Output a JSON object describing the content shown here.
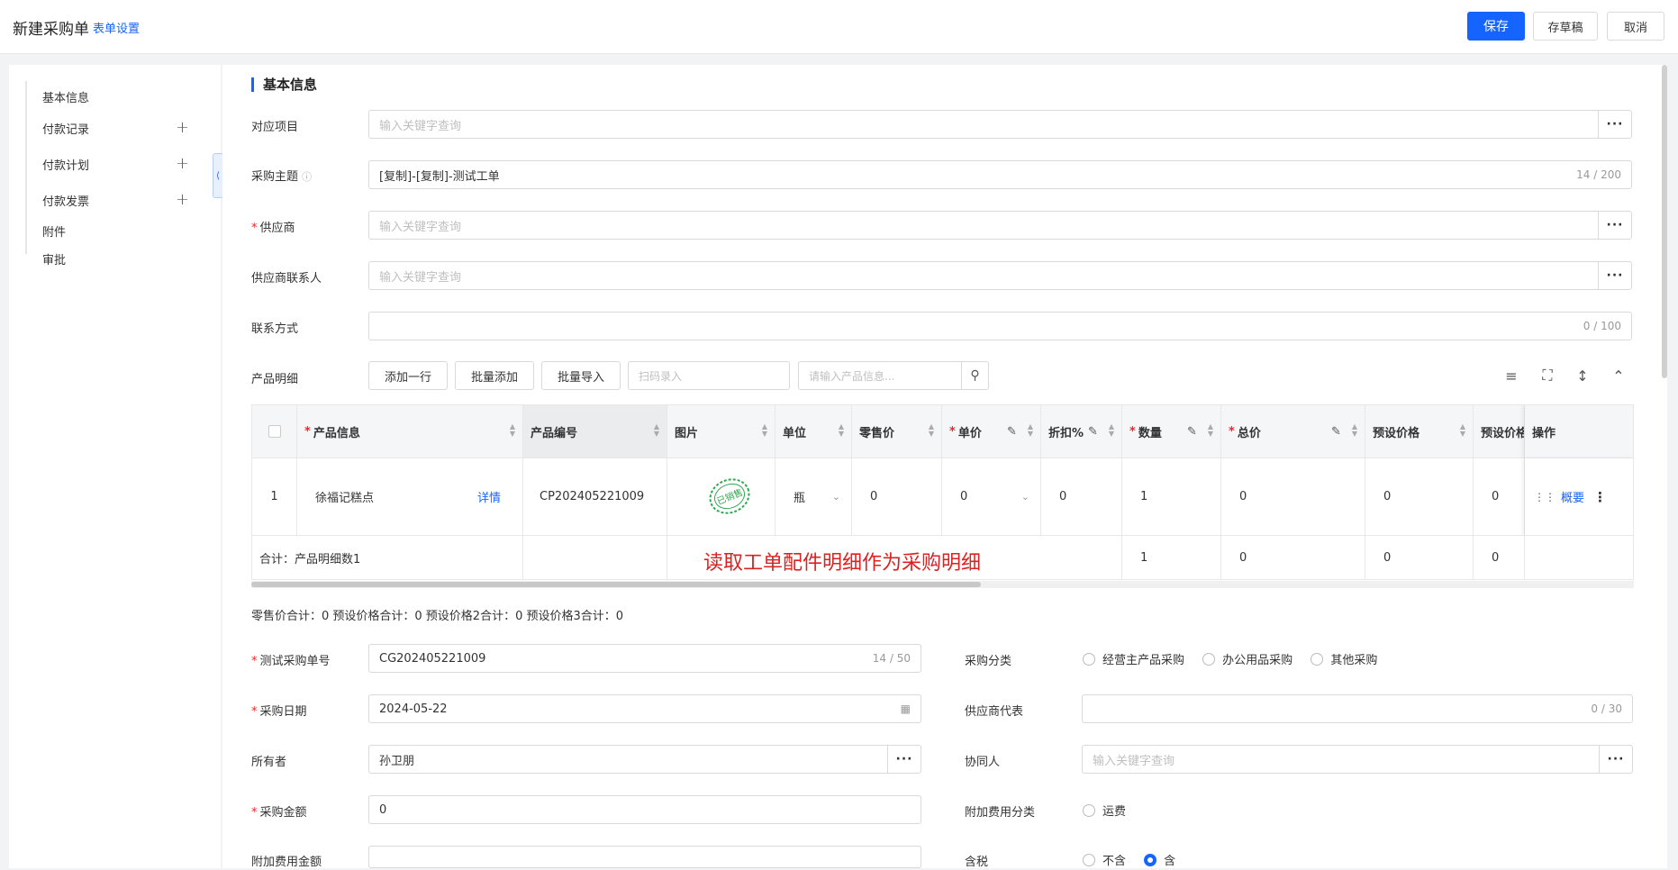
{
  "header": {
    "title": "新建采购单",
    "form_settings": "表单设置",
    "save": "保存",
    "draft": "存草稿",
    "cancel": "取消"
  },
  "sidebar": {
    "items": [
      "基本信息",
      "付款记录",
      "付款计划",
      "付款发票",
      "附件",
      "审批"
    ]
  },
  "section": {
    "title": "基本信息"
  },
  "fields": {
    "project": {
      "label": "对应项目",
      "placeholder": "输入关键字查询"
    },
    "subject": {
      "label": "采购主题",
      "value": "[复制]-[复制]-测试工单",
      "count": "14 / 200"
    },
    "supplier": {
      "label": "供应商",
      "placeholder": "输入关键字查询"
    },
    "contact": {
      "label": "供应商联系人",
      "placeholder": "输入关键字查询"
    },
    "phone": {
      "label": "联系方式",
      "count": "0 / 100"
    },
    "order_no": {
      "label": "测试采购单号",
      "value": "CG202405221009",
      "count": "14 / 50"
    },
    "category": {
      "label": "采购分类",
      "options": [
        "经营主产品采购",
        "办公用品采购",
        "其他采购"
      ]
    },
    "date": {
      "label": "采购日期",
      "value": "2024-05-22"
    },
    "rep": {
      "label": "供应商代表",
      "count": "0 / 30"
    },
    "owner": {
      "label": "所有者",
      "value": "孙卫朋"
    },
    "partner": {
      "label": "协同人",
      "placeholder": "输入关键字查询"
    },
    "amount": {
      "label": "采购金额",
      "value": "0"
    },
    "extra_category": {
      "label": "附加费用分类",
      "option": "运费"
    },
    "extra_amount": {
      "label": "附加费用金额"
    },
    "tax": {
      "label": "含税",
      "options": [
        "不含",
        "含"
      ]
    }
  },
  "products": {
    "label": "产品明细",
    "add_row": "添加一行",
    "batch_add": "批量添加",
    "batch_import": "批量导入",
    "scan_placeholder": "扫码录入",
    "search_placeholder": "请输入产品信息...",
    "columns": [
      "产品信息",
      "产品编号",
      "图片",
      "单位",
      "零售价",
      "单价",
      "折扣%",
      "数量",
      "总价",
      "预设价格",
      "预设价格",
      "操作"
    ],
    "row": {
      "index": "1",
      "name": "徐福记糕点",
      "detail": "详情",
      "code": "CP202405221009",
      "unit": "瓶",
      "retail": "0",
      "price": "0",
      "discount": "0",
      "qty": "1",
      "total": "0",
      "preset": "0",
      "preset2": "0",
      "action": "概要"
    },
    "summary": {
      "label": "合计：产品明细数1",
      "qty": "1",
      "total": "0",
      "preset": "0",
      "preset2": "0"
    },
    "stamp_text": "已销售",
    "overlay": "读取工单配件明细作为采购明细",
    "totals": "零售价合计：0  预设价格合计：0  预设价格2合计：0  预设价格3合计：0"
  }
}
